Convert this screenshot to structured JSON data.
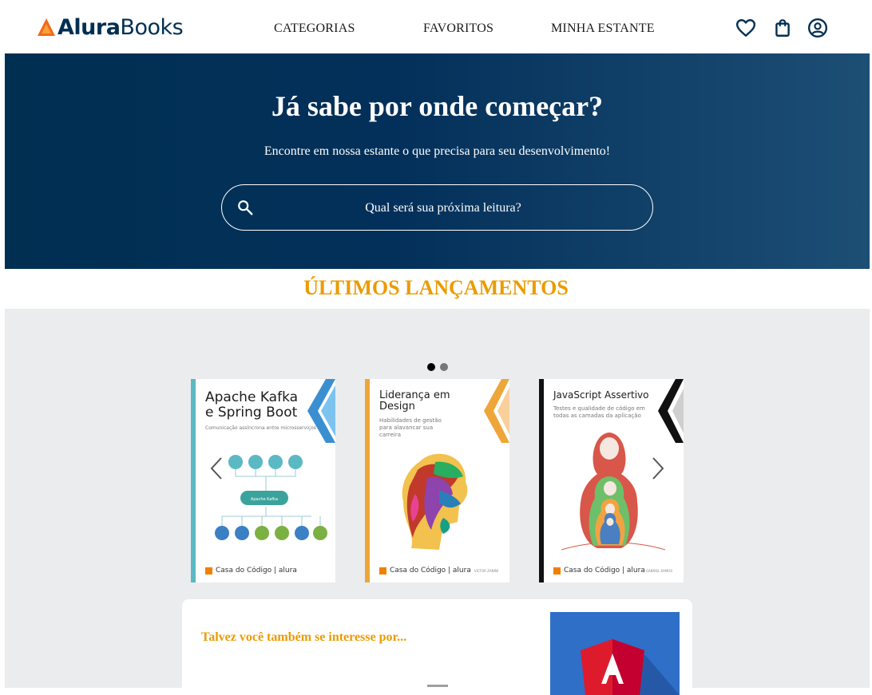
{
  "header": {
    "logo": {
      "brand_bold": "Alura",
      "brand_light": "Books"
    },
    "nav": [
      "CATEGORIAS",
      "FAVORITOS",
      "MINHA ESTANTE"
    ],
    "icons": [
      "heart-icon",
      "shopping-bag-icon",
      "user-circle-icon"
    ]
  },
  "hero": {
    "title": "Já sabe por onde começar?",
    "subtitle": "Encontre em nossa estante o que precisa para seu desenvolvimento!",
    "search_placeholder": "Qual será sua próxima leitura?"
  },
  "releases": {
    "title": "ÚLTIMOS LANÇAMENTOS",
    "carousel": {
      "active_page": 1,
      "pages": 2,
      "books": [
        {
          "title": "Apache Kafka e Spring Boot",
          "subtitle": "Comunicação assíncrona entre microsserviços",
          "publisher": "Casa do Código | alura",
          "accent": "#5bb9c4",
          "diagram_label": "Apache Kafka"
        },
        {
          "title": "Liderança em Design",
          "subtitle": "Habilidades de gestão para alavancar sua carreira",
          "publisher": "Casa do Código | alura",
          "author": "VICTOR ZANINI",
          "accent": "#eea638"
        },
        {
          "title": "JavaScript Assertivo",
          "subtitle": "Testes e qualidade de código em todas as camadas da aplicação",
          "publisher": "Casa do Código | alura",
          "author": "GABRIEL RAMOS",
          "accent": "#111111"
        }
      ]
    }
  },
  "suggestion": {
    "title": "Talvez você também se interesse por..."
  },
  "colors": {
    "brand_dark": "#002f52",
    "accent": "#eb9b00",
    "gray_bg": "#ebecee"
  }
}
